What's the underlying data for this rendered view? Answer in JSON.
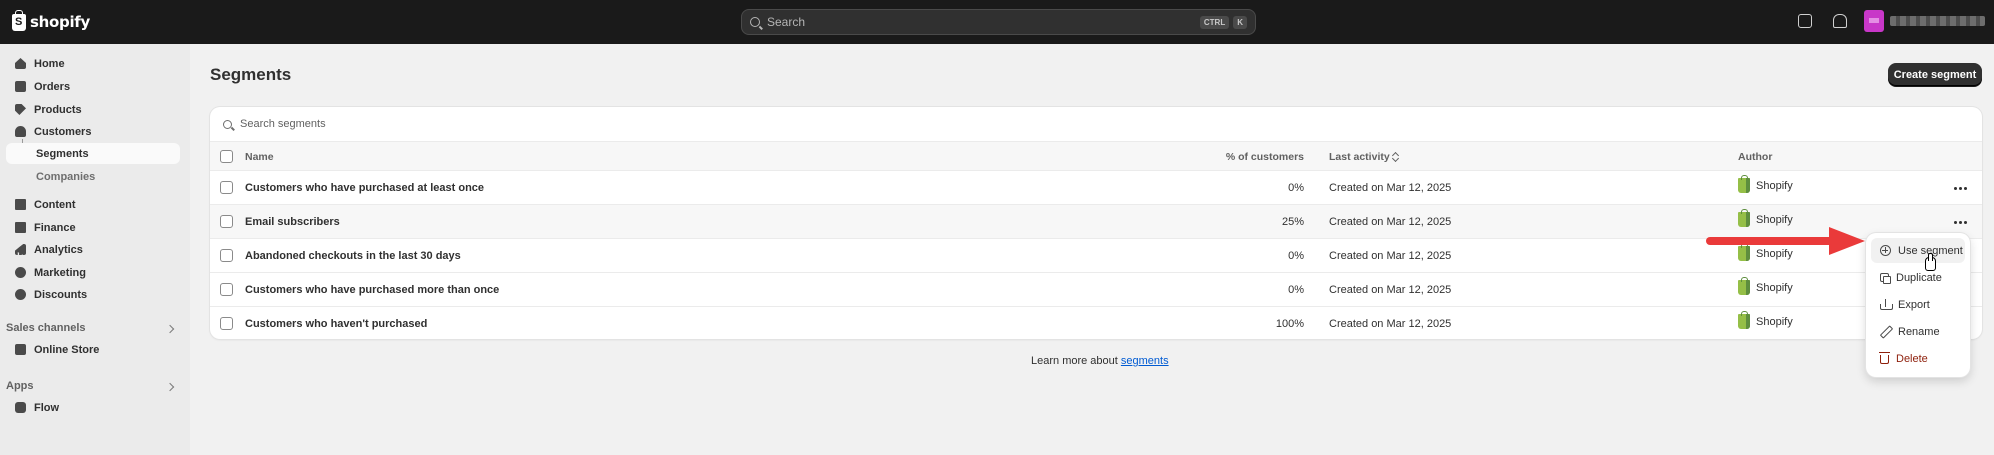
{
  "topbar": {
    "brand": "shopify",
    "search_placeholder": "Search",
    "shortcut_keys": [
      "CTRL",
      "K"
    ]
  },
  "sidebar": {
    "items": [
      {
        "label": "Home",
        "icon": "home-icon"
      },
      {
        "label": "Orders",
        "icon": "orders-icon"
      },
      {
        "label": "Products",
        "icon": "tag-icon"
      },
      {
        "label": "Customers",
        "icon": "person-icon"
      },
      {
        "label": "Segments",
        "icon": "",
        "active": true
      },
      {
        "label": "Companies",
        "icon": ""
      },
      {
        "label": "Content",
        "icon": "content-icon"
      },
      {
        "label": "Finance",
        "icon": "finance-icon"
      },
      {
        "label": "Analytics",
        "icon": "analytics-icon"
      },
      {
        "label": "Marketing",
        "icon": "target-icon"
      },
      {
        "label": "Discounts",
        "icon": "discount-icon"
      }
    ],
    "sales_channels_label": "Sales channels",
    "online_store_label": "Online Store",
    "apps_label": "Apps",
    "flow_label": "Flow"
  },
  "page": {
    "title": "Segments",
    "create_button": "Create segment",
    "search_placeholder": "Search segments",
    "columns": {
      "name": "Name",
      "percent": "% of customers",
      "last_activity": "Last activity",
      "author": "Author"
    },
    "rows": [
      {
        "name": "Customers who have purchased at least once",
        "percent": "0%",
        "activity": "Created on Mar 12, 2025",
        "author": "Shopify"
      },
      {
        "name": "Email subscribers",
        "percent": "25%",
        "activity": "Created on Mar 12, 2025",
        "author": "Shopify"
      },
      {
        "name": "Abandoned checkouts in the last 30 days",
        "percent": "0%",
        "activity": "Created on Mar 12, 2025",
        "author": "Shopify"
      },
      {
        "name": "Customers who have purchased more than once",
        "percent": "0%",
        "activity": "Created on Mar 12, 2025",
        "author": "Shopify"
      },
      {
        "name": "Customers who haven't purchased",
        "percent": "100%",
        "activity": "Created on Mar 12, 2025",
        "author": "Shopify"
      }
    ],
    "learn_more_prefix": "Learn more about ",
    "learn_more_link": "segments"
  },
  "context_menu": {
    "items": [
      {
        "label": "Use segment",
        "icon": "plus-circle-icon"
      },
      {
        "label": "Duplicate",
        "icon": "duplicate-icon"
      },
      {
        "label": "Export",
        "icon": "export-icon"
      },
      {
        "label": "Rename",
        "icon": "pencil-icon"
      },
      {
        "label": "Delete",
        "icon": "trash-icon"
      }
    ]
  },
  "colors": {
    "topbar": "#1a1a1a",
    "annotation_arrow": "#ea3a3a",
    "link": "#005bd3",
    "danger": "#8e1f0b",
    "shopify_green": "#95bf47"
  }
}
